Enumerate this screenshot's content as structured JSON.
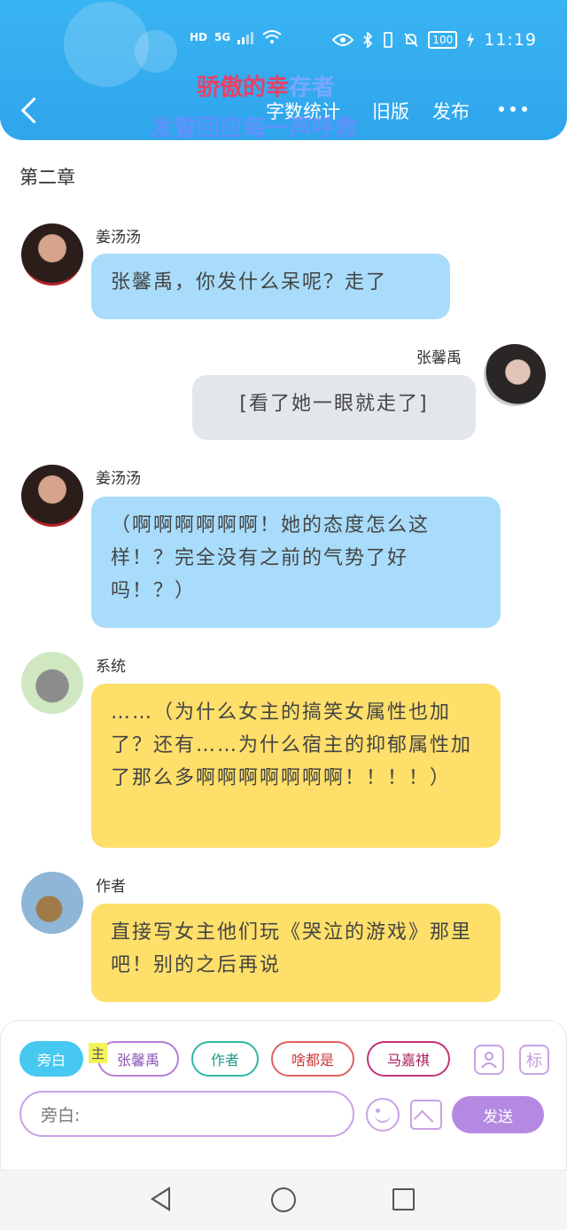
{
  "status_bar": {
    "network_left": "HD",
    "network_5g": "5G",
    "battery": "100",
    "time": "11:19"
  },
  "header": {
    "overlay_title_red": "骄傲的幸",
    "overlay_title_blue": "存者",
    "overlay_subtitle": "发誓回应每一声呼救",
    "word_count": "字数统计",
    "old_version": "旧版",
    "publish": "发布"
  },
  "chapter_title": "第二章",
  "messages": [
    {
      "sender": "姜汤汤",
      "text": "张馨禹，你发什么呆呢？走了"
    },
    {
      "sender": "张馨禹",
      "text": "[看了她一眼就走了]"
    },
    {
      "sender": "姜汤汤",
      "text": "（啊啊啊啊啊啊！她的态度怎么这样！？完全没有之前的气势了好吗！？）"
    },
    {
      "sender": "系统",
      "text": "……（为什么女主的搞笑女属性也加了？还有……为什么宿主的抑郁属性加了那么多啊啊啊啊啊啊啊！！！！）"
    },
    {
      "sender": "作者",
      "text": "直接写女主他们玩《哭泣的游戏》那里吧！别的之后再说"
    }
  ],
  "role_chips": [
    "旁白",
    "张馨禹",
    "作者",
    "啥都是",
    "马嘉祺"
  ],
  "main_tag": "主",
  "tag_icon": "标",
  "input_placeholder": "旁白:",
  "send_label": "发送",
  "colors": {
    "header_blue": "#39b4f2",
    "bubble_blue": "#a8dcfa",
    "bubble_gray": "#e3e7ec",
    "bubble_yellow": "#fddf6a",
    "accent_purple": "#b589e2"
  },
  "icons": [
    "back-icon",
    "more-icon",
    "person-icon",
    "tag-icon",
    "emoji-icon",
    "image-icon",
    "nav-back-icon",
    "nav-home-icon",
    "nav-recent-icon"
  ]
}
